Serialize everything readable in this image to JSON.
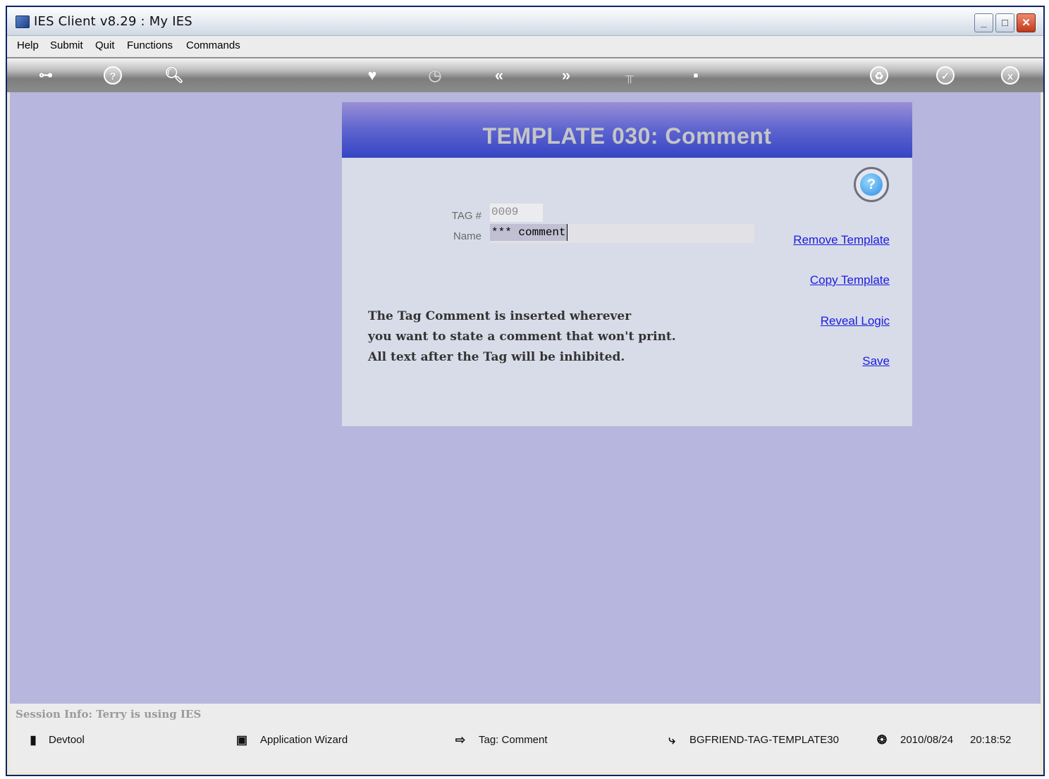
{
  "window": {
    "title": "IES Client v8.29 : My IES"
  },
  "menu": [
    "Help",
    "Submit",
    "Quit",
    "Functions",
    "Commands"
  ],
  "toolbar": {
    "icons": [
      "key-icon",
      "help-icon",
      "search-icon",
      "heart-icon",
      "clock-icon",
      "rewind-icon",
      "forward-icon",
      "tree-icon",
      "chip-icon",
      "recycle-icon",
      "check-icon",
      "close-icon"
    ]
  },
  "panel": {
    "title": "TEMPLATE 030: Comment",
    "tag_label": "TAG #",
    "tag_value": "0009",
    "name_label": "Name",
    "name_value": "*** comment",
    "description": [
      "The Tag Comment is inserted wherever",
      "you want to state a comment that won't print.",
      "All text after the Tag will be inhibited."
    ],
    "links": [
      "Remove Template",
      "Copy Template",
      "Reveal Logic",
      "Save"
    ]
  },
  "status": {
    "session": "Session Info: Terry is using IES",
    "items": [
      "Devtool",
      "Application Wizard",
      "Tag: Comment",
      "BGFRIEND-TAG-TEMPLATE30"
    ],
    "date": "2010/08/24",
    "time": "20:18:52"
  }
}
